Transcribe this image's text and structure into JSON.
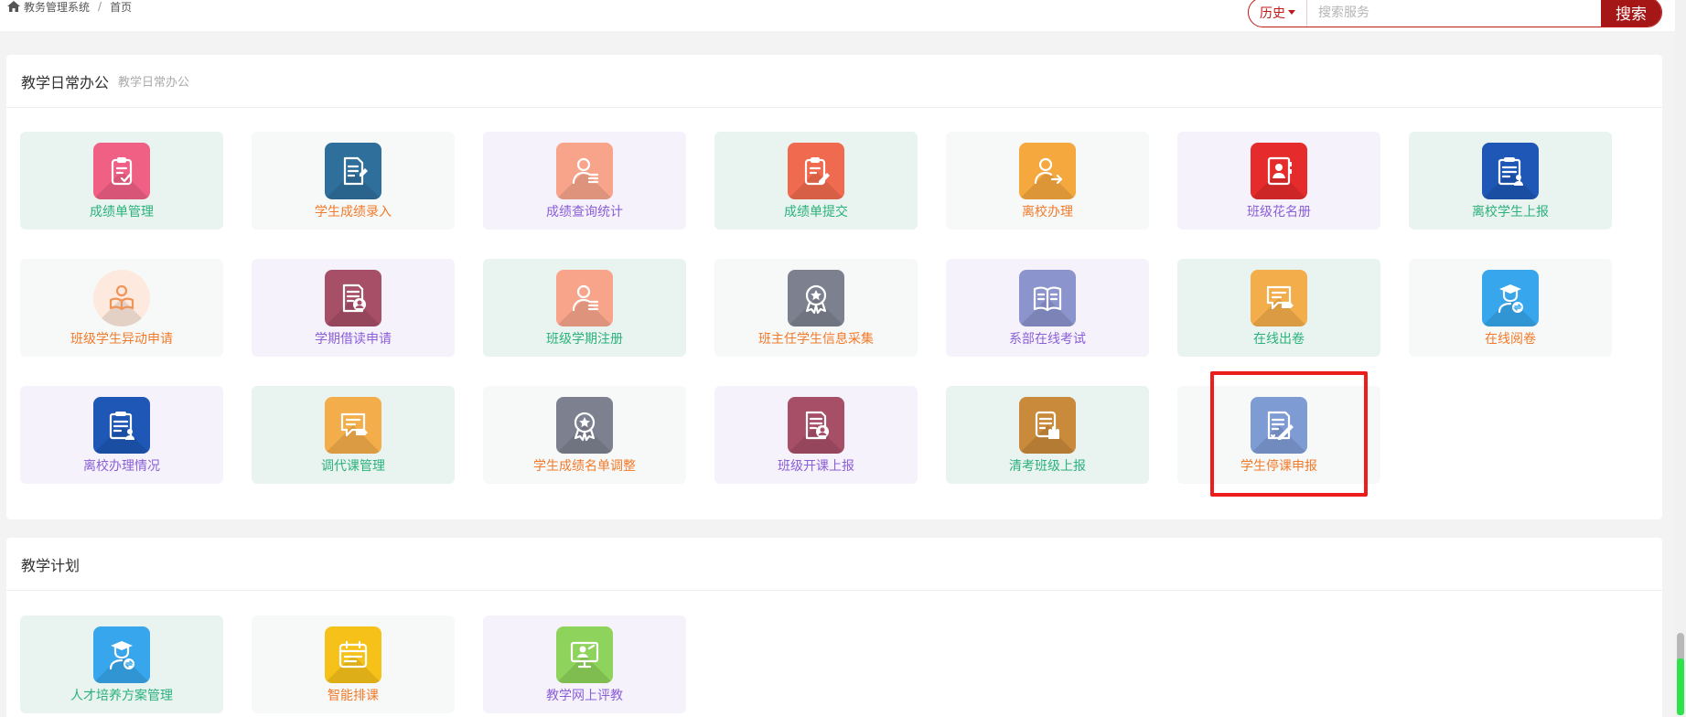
{
  "breadcrumb": {
    "home": "教务管理系统",
    "current": "首页"
  },
  "search": {
    "history_label": "历史",
    "placeholder": "搜索服务",
    "button": "搜索"
  },
  "colors": {
    "brand": "#a51616",
    "highlight": "#ee1d1d",
    "label_green": "#2bb17c",
    "label_orange": "#f27a2b",
    "label_purple": "#8b5fd6"
  },
  "sections": [
    {
      "title": "教学日常办公",
      "subtitle": "教学日常办公",
      "tiles": [
        {
          "label": "成绩单管理",
          "icon": "clipboard-check-icon",
          "bg": "green",
          "text": "green",
          "icon_color": "#f06085"
        },
        {
          "label": "学生成绩录入",
          "icon": "document-edit-icon",
          "bg": "white",
          "text": "orange",
          "icon_color": "#2f6f9b"
        },
        {
          "label": "成绩查询统计",
          "icon": "user-list-icon",
          "bg": "purple",
          "text": "purple",
          "icon_color": "#f8a48b"
        },
        {
          "label": "成绩单提交",
          "icon": "clipboard-edit-icon",
          "bg": "green",
          "text": "green",
          "icon_color": "#ef6a4e"
        },
        {
          "label": "离校办理",
          "icon": "user-exit-icon",
          "bg": "white",
          "text": "orange",
          "icon_color": "#f5a83e"
        },
        {
          "label": "班级花名册",
          "icon": "contact-book-icon",
          "bg": "purple",
          "text": "purple",
          "icon_color": "#e52b2b"
        },
        {
          "label": "离校学生上报",
          "icon": "clipboard-user-icon",
          "bg": "green",
          "text": "green",
          "icon_color": "#1e57b6"
        },
        {
          "label": "班级学生异动申请",
          "icon": "student-reading-icon",
          "bg": "white",
          "text": "orange",
          "icon_color": "#fde9dd",
          "round": true
        },
        {
          "label": "学期借读申请",
          "icon": "document-user-icon",
          "bg": "purple",
          "text": "purple",
          "icon_color": "#a64f67"
        },
        {
          "label": "班级学期注册",
          "icon": "user-list-icon",
          "bg": "green",
          "text": "green",
          "icon_color": "#f8a48b"
        },
        {
          "label": "班主任学生信息采集",
          "icon": "award-badge-icon",
          "bg": "white",
          "text": "orange",
          "icon_color": "#7d808f"
        },
        {
          "label": "系部在线考试",
          "icon": "book-open-icon",
          "bg": "purple",
          "text": "purple",
          "icon_color": "#8b94cc"
        },
        {
          "label": "在线出卷",
          "icon": "chat-pencil-icon",
          "bg": "green",
          "text": "green",
          "icon_color": "#f3ad4a"
        },
        {
          "label": "在线阅卷",
          "icon": "graduate-icon",
          "bg": "white",
          "text": "orange",
          "icon_color": "#37a6ec"
        },
        {
          "label": "离校办理情况",
          "icon": "clipboard-user-icon",
          "bg": "purple",
          "text": "purple",
          "icon_color": "#1e57b6"
        },
        {
          "label": "调代课管理",
          "icon": "chat-pencil-icon",
          "bg": "green",
          "text": "green",
          "icon_color": "#f3ad4a"
        },
        {
          "label": "学生成绩名单调整",
          "icon": "award-badge-icon",
          "bg": "white",
          "text": "orange",
          "icon_color": "#7d808f"
        },
        {
          "label": "班级开课上报",
          "icon": "document-user-icon",
          "bg": "purple",
          "text": "purple",
          "icon_color": "#a64f67"
        },
        {
          "label": "清考班级上报",
          "icon": "document-hand-icon",
          "bg": "green",
          "text": "green",
          "icon_color": "#c98a3c"
        },
        {
          "label": "学生停课申报",
          "icon": "document-sign-icon",
          "bg": "white",
          "text": "orange",
          "icon_color": "#7f9bd4"
        }
      ]
    },
    {
      "title": "教学计划",
      "subtitle": "",
      "tiles": [
        {
          "label": "人才培养方案管理",
          "icon": "graduate-icon",
          "bg": "green",
          "text": "green",
          "icon_color": "#37a6ec"
        },
        {
          "label": "智能排课",
          "icon": "calendar-icon",
          "bg": "white",
          "text": "orange",
          "icon_color": "#f6c21a"
        },
        {
          "label": "教学网上评教",
          "icon": "monitor-user-icon",
          "bg": "purple",
          "text": "purple",
          "icon_color": "#8ed35b"
        }
      ]
    }
  ]
}
